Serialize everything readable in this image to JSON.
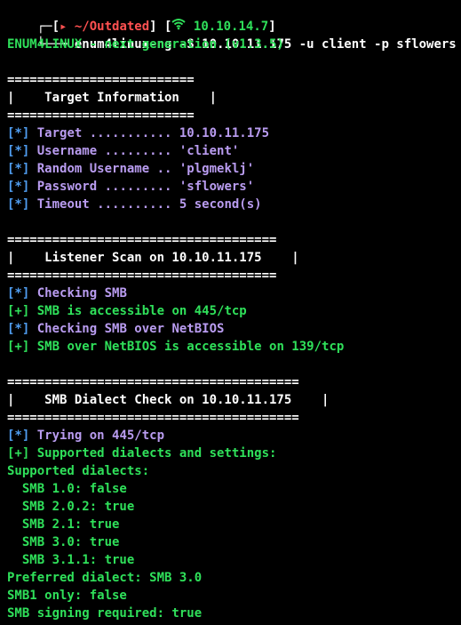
{
  "colors": {
    "background": "#000000",
    "text": "#ffffff",
    "green": "#2fe05a",
    "purple": "#b99cf0",
    "blue": "#4f9df0",
    "red": "#ff5151"
  },
  "prompt": {
    "corner_top": "┌─[",
    "dir": "~/Outdated",
    "ip": "10.10.14.7",
    "corner_bottom": "└──╼ ",
    "command": "enum4linux-ng -S 10.10.11.175 -u client -p sflowers"
  },
  "banner": "ENUM4LINUX - next generation (v1.3.5)",
  "sections": [
    {
      "rule": "=========================",
      "title": "|    Target Information    |",
      "lines": [
        {
          "tag": "[*]",
          "text": "Target ........... 10.10.11.175"
        },
        {
          "tag": "[*]",
          "text": "Username ......... 'client'"
        },
        {
          "tag": "[*]",
          "text": "Random Username .. 'plgmeklj'"
        },
        {
          "tag": "[*]",
          "text": "Password ......... 'sflowers'"
        },
        {
          "tag": "[*]",
          "text": "Timeout .......... 5 second(s)"
        }
      ]
    },
    {
      "rule": "====================================",
      "title": "|    Listener Scan on 10.10.11.175    |",
      "lines": [
        {
          "tag": "[*]",
          "text": "Checking SMB"
        },
        {
          "tag": "[+]",
          "text": "SMB is accessible on 445/tcp"
        },
        {
          "tag": "[*]",
          "text": "Checking SMB over NetBIOS"
        },
        {
          "tag": "[+]",
          "text": "SMB over NetBIOS is accessible on 139/tcp"
        }
      ]
    },
    {
      "rule": "=======================================",
      "title": "|    SMB Dialect Check on 10.10.11.175    |",
      "lines": [
        {
          "tag": "[*]",
          "text": "Trying on 445/tcp"
        },
        {
          "tag": "[+]",
          "text": "Supported dialects and settings:"
        }
      ]
    }
  ],
  "output": [
    "Supported dialects:",
    "  SMB 1.0: false",
    "  SMB 2.0.2: true",
    "  SMB 2.1: true",
    "  SMB 3.0: true",
    "  SMB 3.1.1: true",
    "Preferred dialect: SMB 3.0",
    "SMB1 only: false",
    "SMB signing required: true"
  ]
}
